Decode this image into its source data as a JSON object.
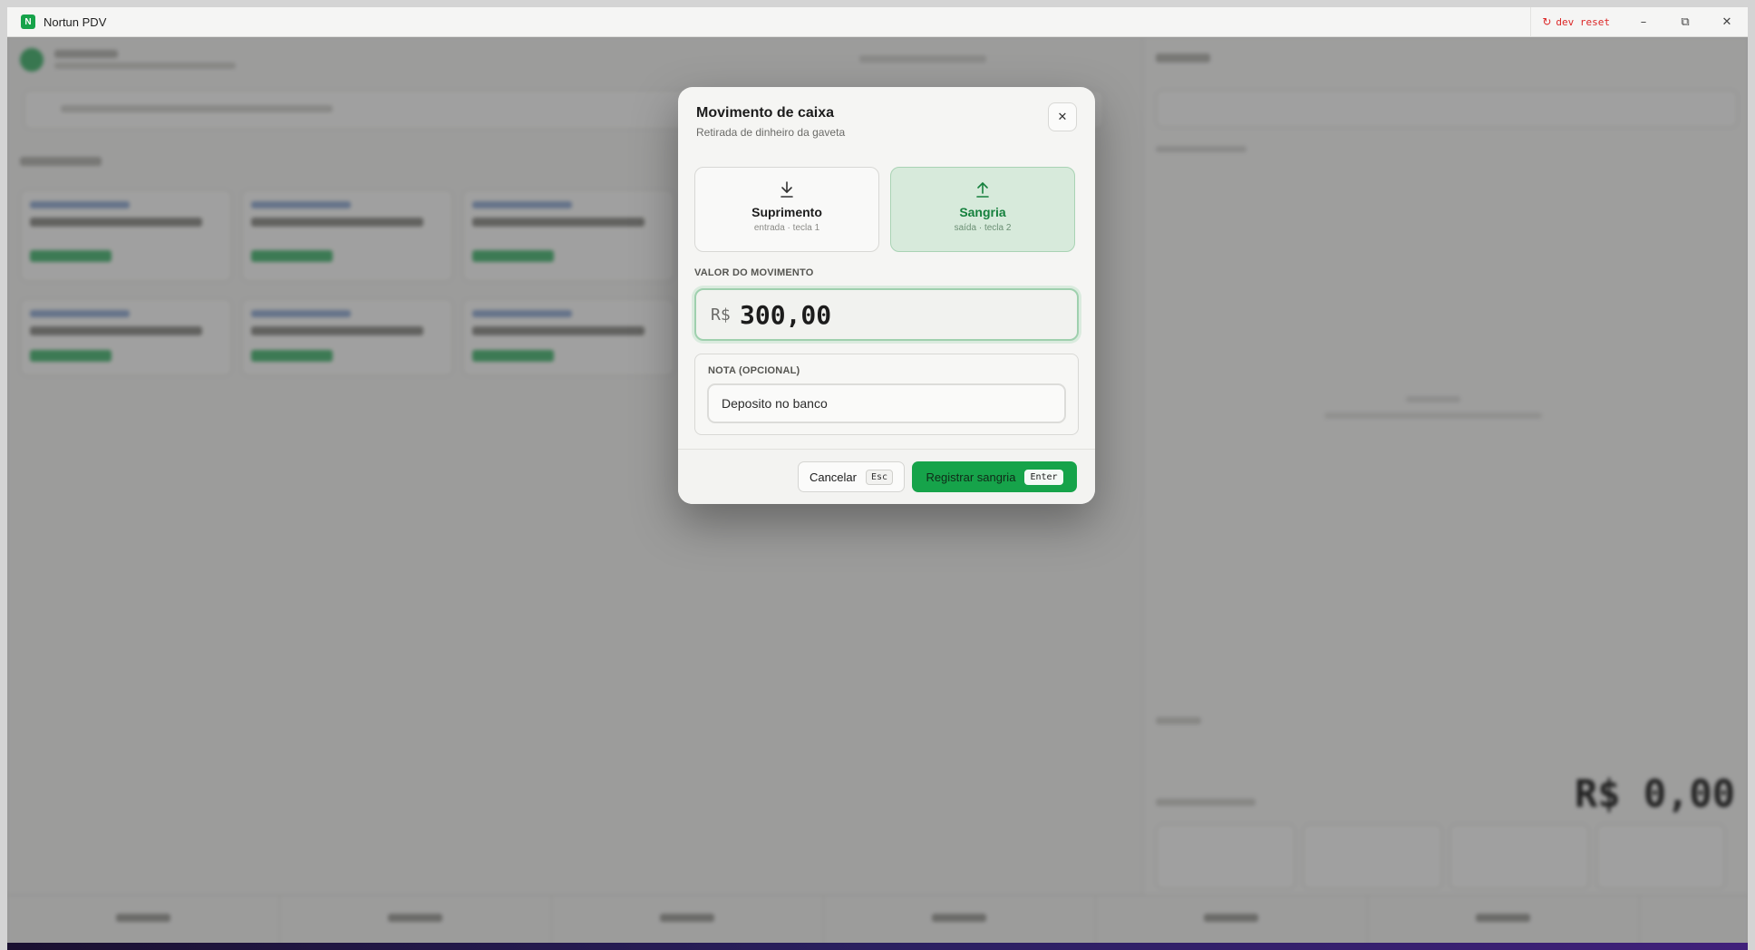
{
  "app": {
    "logo_letter": "N",
    "title": "Nortun PDV",
    "dev_reset_label": "dev reset",
    "window_controls": {
      "minimize": "–",
      "restore": "⧉",
      "close": "✕"
    }
  },
  "background": {
    "total_display": "R$ 0,00"
  },
  "modal": {
    "title": "Movimento de caixa",
    "subtitle": "Retirada de dinheiro da gaveta",
    "close_glyph": "✕",
    "types": [
      {
        "name": "Suprimento",
        "hint": "entrada · tecla 1",
        "icon": "download-icon",
        "selected": false
      },
      {
        "name": "Sangria",
        "hint": "saída · tecla 2",
        "icon": "upload-icon",
        "selected": true
      }
    ],
    "value_label": "VALOR DO MOVIMENTO",
    "currency": "R$",
    "amount": "300,00",
    "note_label": "NOTA (OPCIONAL)",
    "note_value": "Deposito no banco",
    "cancel_label": "Cancelar",
    "cancel_key": "Esc",
    "submit_label": "Registrar sangria",
    "submit_key": "Enter"
  },
  "colors": {
    "accent": "#16a34a",
    "selected_bg": "#d7eadb",
    "danger": "#dc2626"
  }
}
